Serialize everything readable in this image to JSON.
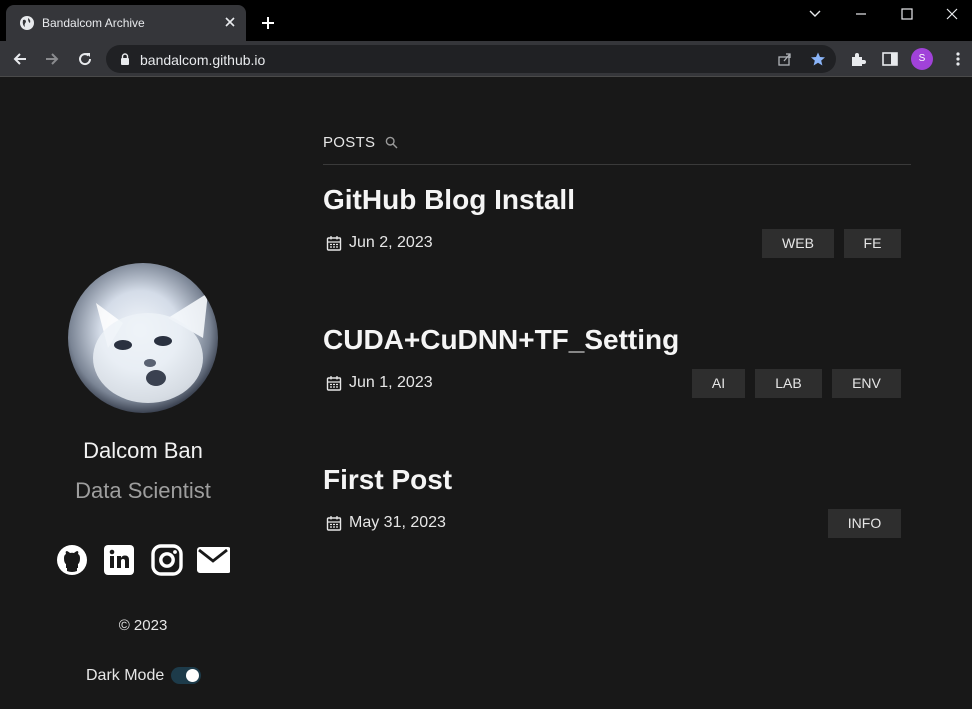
{
  "browser": {
    "tab_title": "Bandalcom Archive",
    "url": "bandalcom.github.io",
    "profile_initial": "S"
  },
  "sidebar": {
    "name": "Dalcom Ban",
    "role": "Data Scientist",
    "social": [
      "github-icon",
      "linkedin-icon",
      "instagram-icon",
      "mail-icon"
    ],
    "copyright": "© 2023",
    "dark_mode_label": "Dark Mode",
    "dark_mode_on": true
  },
  "main": {
    "section_label": "POSTS",
    "posts": [
      {
        "title": "GitHub Blog Install",
        "date": "Jun 2, 2023",
        "tags": [
          "WEB",
          "FE"
        ]
      },
      {
        "title": "CUDA+CuDNN+TF_Setting",
        "date": "Jun 1, 2023",
        "tags": [
          "AI",
          "LAB",
          "ENV"
        ]
      },
      {
        "title": "First Post",
        "date": "May 31, 2023",
        "tags": [
          "INFO"
        ]
      }
    ]
  },
  "colors": {
    "background": "#181818",
    "tag_bg": "#2e2e2e",
    "star_blue": "#8ab4f8",
    "profile_purple": "#a142d9"
  }
}
